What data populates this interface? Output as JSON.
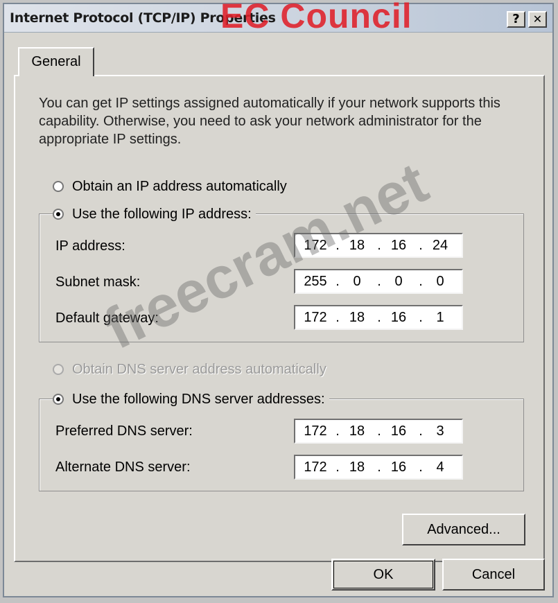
{
  "window": {
    "title": "Internet Protocol (TCP/IP) Properties",
    "help_label": "?",
    "close_label": "✕"
  },
  "watermarks": {
    "top": "EC Council",
    "diagonal": "freecram.net"
  },
  "tabs": [
    {
      "label": "General"
    }
  ],
  "intro": "You can get IP settings assigned automatically if your network supports this capability. Otherwise, you need to ask your network administrator for the appropriate IP settings.",
  "ip_section": {
    "auto_label": "Obtain an IP address automatically",
    "manual_label": "Use the following IP address:",
    "selected": "manual",
    "fields": [
      {
        "label": "IP address:",
        "octets": [
          "172",
          "18",
          "16",
          "24"
        ]
      },
      {
        "label": "Subnet mask:",
        "octets": [
          "255",
          "0",
          "0",
          "0"
        ]
      },
      {
        "label": "Default gateway:",
        "octets": [
          "172",
          "18",
          "16",
          "1"
        ]
      }
    ]
  },
  "dns_section": {
    "auto_label": "Obtain DNS server address automatically",
    "manual_label": "Use the following DNS server addresses:",
    "selected": "manual",
    "fields": [
      {
        "label": "Preferred DNS server:",
        "octets": [
          "172",
          "18",
          "16",
          "3"
        ]
      },
      {
        "label": "Alternate DNS server:",
        "octets": [
          "172",
          "18",
          "16",
          "4"
        ]
      }
    ]
  },
  "buttons": {
    "advanced": "Advanced...",
    "ok": "OK",
    "cancel": "Cancel"
  }
}
